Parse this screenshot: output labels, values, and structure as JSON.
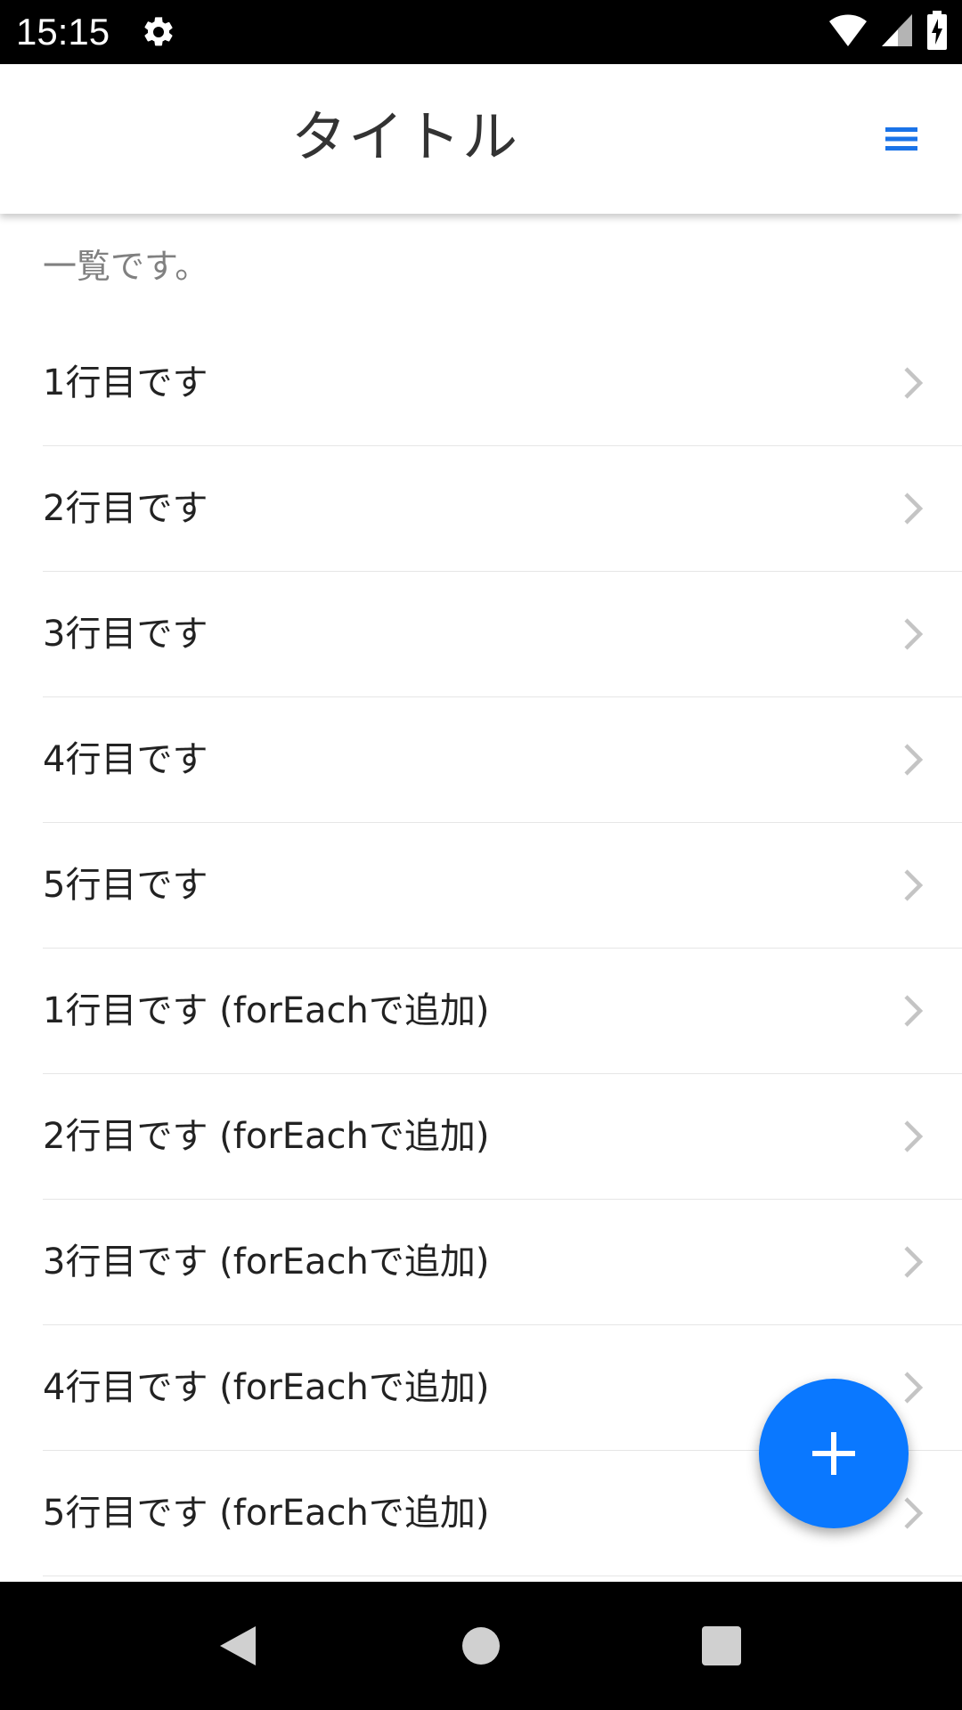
{
  "status_bar": {
    "time": "15:15",
    "icons": [
      "settings-gear-icon",
      "wifi-icon",
      "cell-signal-icon",
      "battery-charging-icon"
    ]
  },
  "header": {
    "title": "タイトル",
    "menu_icon": "hamburger-menu-icon",
    "accent_color": "#1a73e8"
  },
  "list": {
    "header": "一覧です。",
    "items": [
      {
        "label": "1行目です"
      },
      {
        "label": "2行目です"
      },
      {
        "label": "3行目です"
      },
      {
        "label": "4行目です"
      },
      {
        "label": "5行目です"
      },
      {
        "label": "1行目です (forEachで追加)"
      },
      {
        "label": "2行目です (forEachで追加)"
      },
      {
        "label": "3行目です (forEachで追加)"
      },
      {
        "label": "4行目です (forEachで追加)"
      },
      {
        "label": "5行目です (forEachで追加)"
      }
    ],
    "item_icon": "chevron-right-icon"
  },
  "fab": {
    "icon": "plus-icon",
    "color": "#0a78ff"
  },
  "nav_bar": {
    "buttons": [
      "back-triangle-icon",
      "home-circle-icon",
      "recents-square-icon"
    ]
  }
}
